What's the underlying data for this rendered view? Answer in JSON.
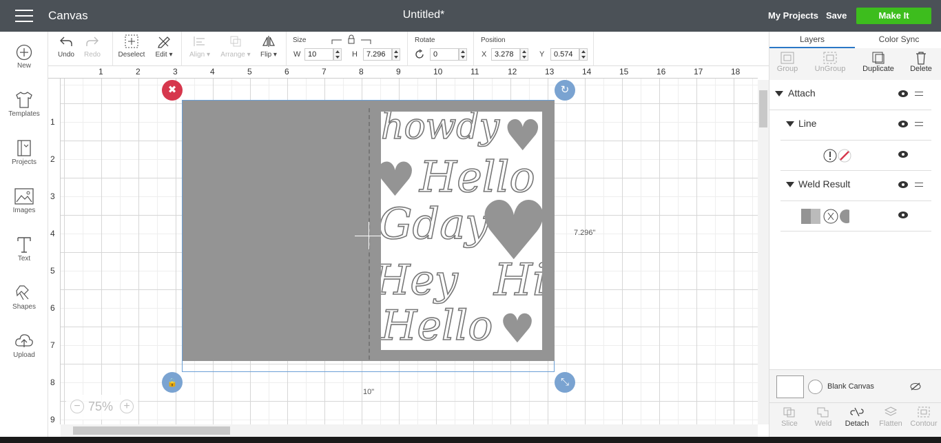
{
  "app": {
    "title": "Canvas",
    "doc_title": "Untitled*",
    "my_projects": "My Projects",
    "save": "Save",
    "make_it": "Make It"
  },
  "nav": [
    {
      "label": "New",
      "icon": "plus-circle-icon"
    },
    {
      "label": "Templates",
      "icon": "shirt-icon"
    },
    {
      "label": "Projects",
      "icon": "book-icon"
    },
    {
      "label": "Images",
      "icon": "image-icon"
    },
    {
      "label": "Text",
      "icon": "text-icon"
    },
    {
      "label": "Shapes",
      "icon": "shapes-icon"
    },
    {
      "label": "Upload",
      "icon": "cloud-upload-icon"
    }
  ],
  "toolbar": {
    "undo": "Undo",
    "redo": "Redo",
    "deselect": "Deselect",
    "edit": "Edit",
    "align": "Align",
    "arrange": "Arrange",
    "flip": "Flip",
    "size_label": "Size",
    "w_label": "W",
    "w_value": "10",
    "h_label": "H",
    "h_value": "7.296",
    "rotate_label": "Rotate",
    "rotate_value": "0",
    "position_label": "Position",
    "x_label": "X",
    "x_value": "3.278",
    "y_label": "Y",
    "y_value": "0.574"
  },
  "ruler": {
    "top": [
      "1",
      "2",
      "3",
      "4",
      "5",
      "6",
      "7",
      "8",
      "9",
      "10",
      "11",
      "12",
      "13",
      "14",
      "15",
      "16",
      "17",
      "18"
    ],
    "left": [
      "1",
      "2",
      "3",
      "4",
      "5",
      "6",
      "7",
      "8",
      "9"
    ]
  },
  "design": {
    "words": [
      "howdy",
      "Hello",
      "Gday",
      "Hey",
      "Hi",
      "Hello"
    ],
    "heart_glyph": "♥"
  },
  "canvas": {
    "width_label": "10\"",
    "height_label": "7.296\"",
    "zoom": "75%",
    "zoom_minus": "−",
    "zoom_plus": "+",
    "delete_glyph": "✖",
    "rotate_glyph": "↻",
    "lock_glyph": "🔒",
    "resize_glyph": "⤡"
  },
  "panel": {
    "tabs": [
      "Layers",
      "Color Sync"
    ],
    "tools": [
      "Group",
      "UnGroup",
      "Duplicate",
      "Delete"
    ],
    "layers": [
      {
        "name": "Attach",
        "indent": 0
      },
      {
        "name": "Line",
        "indent": 1
      },
      {
        "name": "",
        "indent": 2
      },
      {
        "name": "Weld Result",
        "indent": 1
      },
      {
        "name": "",
        "indent": 2
      }
    ],
    "blank_canvas": "Blank Canvas",
    "bottom_tools": [
      "Slice",
      "Weld",
      "Detach",
      "Flatten",
      "Contour"
    ]
  },
  "colors": {
    "topbar": "#4b5157",
    "make_it": "#3dbd1d",
    "card": "#949494",
    "handle_red": "#d6374d",
    "handle_blue": "#7aa3d1"
  }
}
